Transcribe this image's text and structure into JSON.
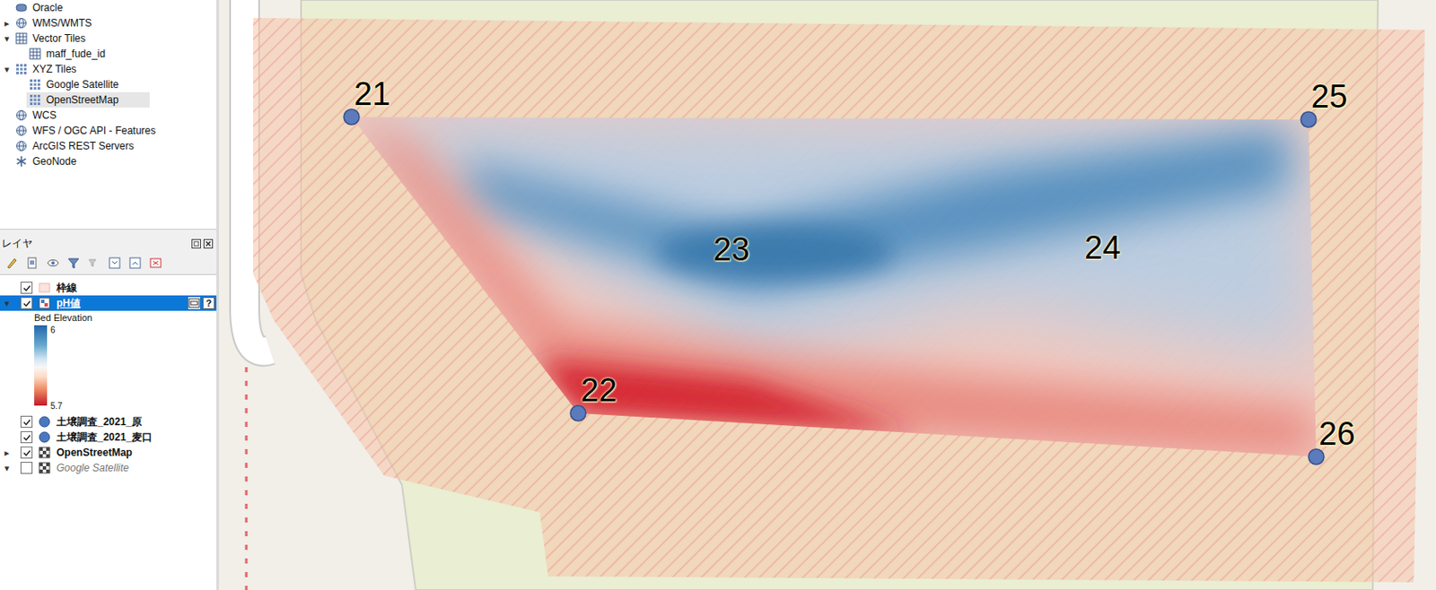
{
  "browser": {
    "items": [
      {
        "label": "Oracle",
        "kind": "database",
        "depth": 0,
        "arrow": "",
        "selected": false
      },
      {
        "label": "WMS/WMTS",
        "kind": "globe",
        "depth": 0,
        "arrow": "▸",
        "selected": false
      },
      {
        "label": "Vector Tiles",
        "kind": "grid",
        "depth": 0,
        "arrow": "▾",
        "selected": false
      },
      {
        "label": "maff_fude_id",
        "kind": "grid",
        "depth": 1,
        "arrow": "",
        "selected": false
      },
      {
        "label": "XYZ Tiles",
        "kind": "tiles",
        "depth": 0,
        "arrow": "▾",
        "selected": false
      },
      {
        "label": "Google Satellite",
        "kind": "tiles",
        "depth": 1,
        "arrow": "",
        "selected": false
      },
      {
        "label": "OpenStreetMap",
        "kind": "tiles",
        "depth": 1,
        "arrow": "",
        "selected": true
      },
      {
        "label": "WCS",
        "kind": "globe",
        "depth": 0,
        "arrow": "",
        "selected": false
      },
      {
        "label": "WFS / OGC API - Features",
        "kind": "globe",
        "depth": 0,
        "arrow": "",
        "selected": false
      },
      {
        "label": "ArcGIS REST Servers",
        "kind": "globe",
        "depth": 0,
        "arrow": "",
        "selected": false
      },
      {
        "label": "GeoNode",
        "kind": "geonode",
        "depth": 0,
        "arrow": "",
        "selected": false
      }
    ]
  },
  "layers_panel": {
    "title": "レイヤ"
  },
  "layers": [
    {
      "label": "枠線",
      "kind": "polygon",
      "checked": true,
      "selected": false,
      "arrow": ""
    },
    {
      "label": "pH値",
      "kind": "raster",
      "checked": true,
      "selected": true,
      "arrow": "▾",
      "help": "?",
      "legend": {
        "title": "Bed Elevation",
        "max": "6",
        "min": "5.7"
      }
    },
    {
      "label": "土壌調査_2021_原",
      "kind": "point",
      "checked": true,
      "selected": false,
      "arrow": ""
    },
    {
      "label": "土壌調査_2021_麦口",
      "kind": "point",
      "checked": true,
      "selected": false,
      "arrow": ""
    },
    {
      "label": "OpenStreetMap",
      "kind": "tiles",
      "checked": true,
      "selected": false,
      "arrow": "▸"
    },
    {
      "label": "Google Satellite",
      "kind": "tiles",
      "checked": false,
      "selected": false,
      "arrow": "▾"
    }
  ],
  "map": {
    "points": [
      {
        "label": "21",
        "marker": true
      },
      {
        "label": "22",
        "marker": true
      },
      {
        "label": "23",
        "marker": false
      },
      {
        "label": "24",
        "marker": false
      },
      {
        "label": "25",
        "marker": true
      },
      {
        "label": "26",
        "marker": true
      }
    ]
  }
}
